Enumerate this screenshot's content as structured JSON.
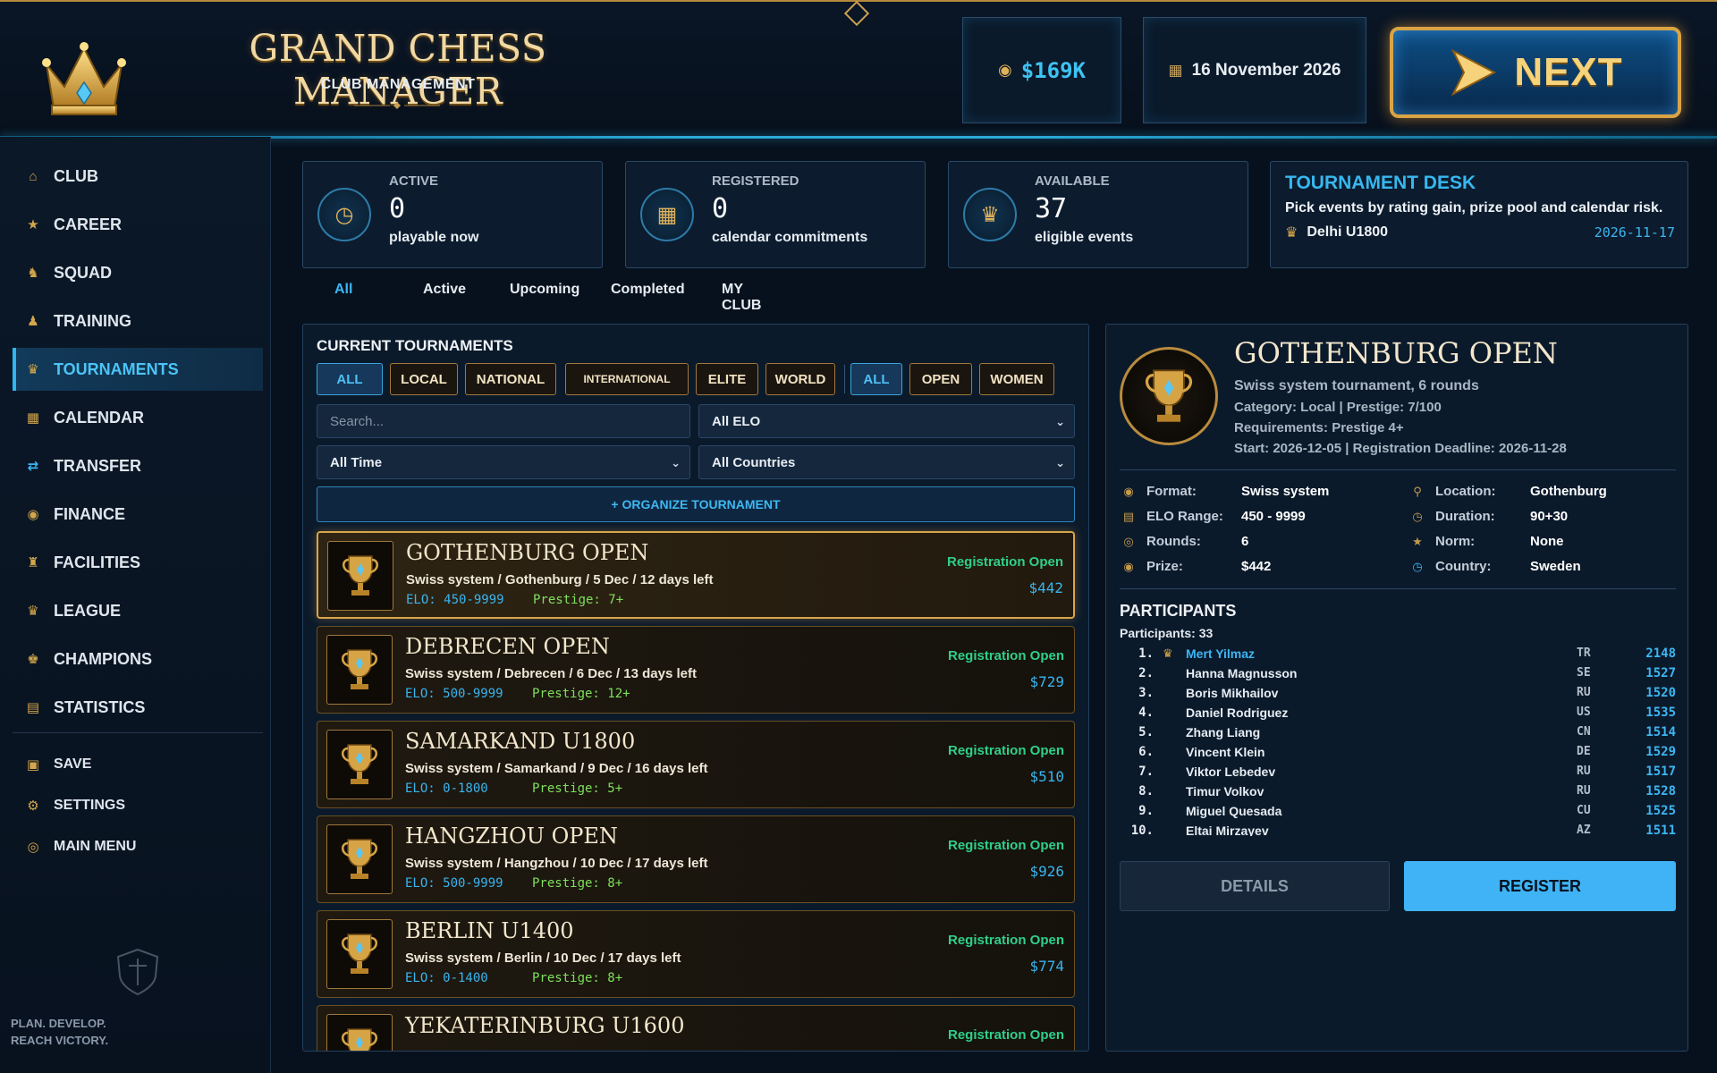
{
  "header": {
    "title": "GRAND CHESS MANAGER",
    "subtitle": "CLUB MANAGEMENT",
    "money": "$169K",
    "date": "16 November 2026",
    "next_label": "NEXT"
  },
  "sidebar": {
    "items": [
      {
        "label": "CLUB",
        "icon": "home-icon"
      },
      {
        "label": "CAREER",
        "icon": "career-icon"
      },
      {
        "label": "SQUAD",
        "icon": "squad-icon"
      },
      {
        "label": "TRAINING",
        "icon": "training-icon"
      },
      {
        "label": "TOURNAMENTS",
        "icon": "trophy-icon"
      },
      {
        "label": "CALENDAR",
        "icon": "calendar-icon"
      },
      {
        "label": "TRANSFER",
        "icon": "transfer-icon"
      },
      {
        "label": "FINANCE",
        "icon": "finance-icon"
      },
      {
        "label": "FACILITIES",
        "icon": "facilities-icon"
      },
      {
        "label": "LEAGUE",
        "icon": "league-icon"
      },
      {
        "label": "CHAMPIONS",
        "icon": "champions-icon"
      },
      {
        "label": "STATISTICS",
        "icon": "statistics-icon"
      }
    ],
    "active": "TOURNAMENTS",
    "system_items": [
      {
        "label": "SAVE",
        "icon": "save-icon"
      },
      {
        "label": "SETTINGS",
        "icon": "gear-icon"
      },
      {
        "label": "MAIN MENU",
        "icon": "menu-icon"
      }
    ],
    "motto_line1": "PLAN. DEVELOP.",
    "motto_line2": "REACH VICTORY."
  },
  "stats": [
    {
      "label": "ACTIVE",
      "value": "0",
      "sub": "playable now",
      "icon": "clock-icon"
    },
    {
      "label": "REGISTERED",
      "value": "0",
      "sub": "calendar commitments",
      "icon": "calendar-icon"
    },
    {
      "label": "AVAILABLE",
      "value": "37",
      "sub": "eligible events",
      "icon": "trophy-icon"
    }
  ],
  "desk": {
    "title": "TOURNAMENT DESK",
    "text": "Pick events by rating gain, prize pool and calendar risk.",
    "event": "Delhi U1800",
    "date": "2026-11-17"
  },
  "tabs": [
    "All",
    "Active",
    "Upcoming",
    "Completed",
    "MY CLUB"
  ],
  "list": {
    "title": "CURRENT TOURNAMENTS",
    "level_chips": [
      "ALL",
      "LOCAL",
      "NATIONAL",
      "INTERNATIONAL",
      "ELITE",
      "WORLD"
    ],
    "type_chips": [
      "ALL",
      "OPEN",
      "WOMEN"
    ],
    "search_placeholder": "Search...",
    "elo_filter": "All ELO",
    "time_filter": "All Time",
    "country_filter": "All Countries",
    "organize_label": "+ ORGANIZE TOURNAMENT",
    "tournaments": [
      {
        "name": "GOTHENBURG OPEN",
        "meta": "Swiss system  /  Gothenburg  /  5 Dec  /  12 days left",
        "elo": "ELO: 450-9999",
        "prestige": "Prestige: 7+",
        "status": "Registration Open",
        "prize": "$442"
      },
      {
        "name": "DEBRECEN OPEN",
        "meta": "Swiss system  /  Debrecen  /  6 Dec  /  13 days left",
        "elo": "ELO: 500-9999",
        "prestige": "Prestige: 12+",
        "status": "Registration Open",
        "prize": "$729"
      },
      {
        "name": "SAMARKAND U1800",
        "meta": "Swiss system  /  Samarkand  /  9 Dec  /  16 days left",
        "elo": "ELO: 0-1800",
        "prestige": "Prestige: 5+",
        "status": "Registration Open",
        "prize": "$510"
      },
      {
        "name": "HANGZHOU OPEN",
        "meta": "Swiss system  /  Hangzhou  /  10 Dec  /  17 days left",
        "elo": "ELO: 500-9999",
        "prestige": "Prestige: 8+",
        "status": "Registration Open",
        "prize": "$926"
      },
      {
        "name": "BERLIN U1400",
        "meta": "Swiss system  /  Berlin  /  10 Dec  /  17 days left",
        "elo": "ELO: 0-1400",
        "prestige": "Prestige: 8+",
        "status": "Registration Open",
        "prize": "$774"
      },
      {
        "name": "YEKATERINBURG U1600",
        "meta": "",
        "elo": "",
        "prestige": "",
        "status": "Registration Open",
        "prize": ""
      }
    ]
  },
  "detail": {
    "name": "GOTHENBURG OPEN",
    "line1": "Swiss system tournament, 6 rounds",
    "line2": "Category: Local  |  Prestige: 7/100",
    "line3": "Requirements: Prestige 4+",
    "line4": "Start: 2026-12-05  |  Registration Deadline: 2026-11-28",
    "attrs_left": [
      {
        "k": "Format:",
        "v": "Swiss system",
        "icon": "format-icon"
      },
      {
        "k": "ELO Range:",
        "v": "450 - 9999",
        "icon": "elo-icon"
      },
      {
        "k": "Rounds:",
        "v": "6",
        "icon": "rounds-icon"
      },
      {
        "k": "Prize:",
        "v": "$442",
        "icon": "prize-icon"
      }
    ],
    "attrs_right": [
      {
        "k": "Location:",
        "v": "Gothenburg",
        "icon": "location-icon"
      },
      {
        "k": "Duration:",
        "v": "90+30",
        "icon": "duration-icon"
      },
      {
        "k": "Norm:",
        "v": "None",
        "icon": "norm-icon"
      },
      {
        "k": "Country:",
        "v": "Sweden",
        "icon": "globe-icon"
      }
    ],
    "participants_title": "PARTICIPANTS",
    "participants_count": "Participants: 33",
    "participants": [
      {
        "num": "1.",
        "name": "Mert Yilmaz",
        "cc": "TR",
        "elo": "2148",
        "me": true
      },
      {
        "num": "2.",
        "name": "Hanna Magnusson",
        "cc": "SE",
        "elo": "1527"
      },
      {
        "num": "3.",
        "name": "Boris Mikhailov",
        "cc": "RU",
        "elo": "1520"
      },
      {
        "num": "4.",
        "name": "Daniel Rodriguez",
        "cc": "US",
        "elo": "1535"
      },
      {
        "num": "5.",
        "name": "Zhang Liang",
        "cc": "CN",
        "elo": "1514"
      },
      {
        "num": "6.",
        "name": "Vincent Klein",
        "cc": "DE",
        "elo": "1529"
      },
      {
        "num": "7.",
        "name": "Viktor Lebedev",
        "cc": "RU",
        "elo": "1517"
      },
      {
        "num": "8.",
        "name": "Timur Volkov",
        "cc": "RU",
        "elo": "1528"
      },
      {
        "num": "9.",
        "name": "Miguel Quesada",
        "cc": "CU",
        "elo": "1525"
      },
      {
        "num": "10.",
        "name": "Eltai Mirzayev",
        "cc": "AZ",
        "elo": "1511"
      }
    ],
    "details_label": "DETAILS",
    "register_label": "REGISTER"
  }
}
